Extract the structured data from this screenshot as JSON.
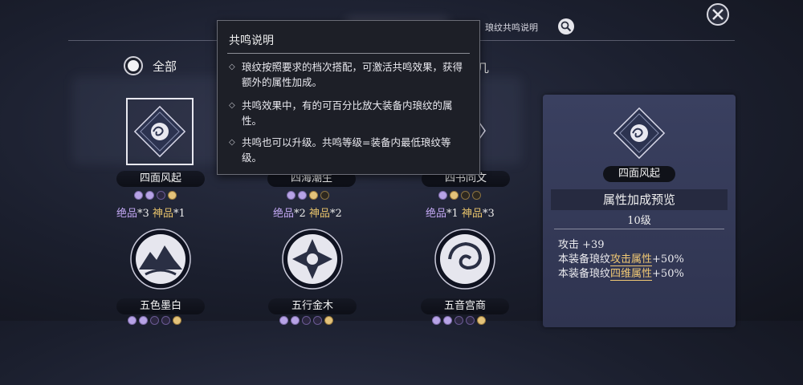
{
  "header": {
    "explain_link": "琅纹共鸣说明",
    "obscured_title": "共鸣"
  },
  "filter": {
    "all_label": "全部",
    "right_partial": "几"
  },
  "cards": [
    {
      "name": "四面风起",
      "purple_label": "绝品",
      "purple_count": "*3",
      "gold_label": "神品",
      "gold_count": "*1",
      "dots": [
        "p",
        "p",
        "pd",
        "g"
      ]
    },
    {
      "name": "四海潮生",
      "purple_label": "绝品",
      "purple_count": "*2",
      "gold_label": "神品",
      "gold_count": "*2",
      "dots": [
        "p",
        "p",
        "g",
        "gd"
      ]
    },
    {
      "name": "四书同文",
      "purple_label": "绝品",
      "purple_count": "*1",
      "gold_label": "神品",
      "gold_count": "*3",
      "dots": [
        "p",
        "g",
        "gd",
        "gd"
      ]
    },
    {
      "name": "五色墨白",
      "dots": [
        "p",
        "p",
        "pd",
        "pd",
        "g"
      ]
    },
    {
      "name": "五行金木",
      "dots": [
        "p",
        "p",
        "pd",
        "pd",
        "g"
      ]
    },
    {
      "name": "五音宫商",
      "dots": [
        "p",
        "p",
        "pd",
        "pd",
        "g"
      ]
    }
  ],
  "tooltip": {
    "title": "共鸣说明",
    "items": [
      "琅纹按照要求的档次搭配，可激活共鸣效果，获得额外的属性加成。",
      "共鸣效果中，有的可百分比放大装备内琅纹的属性。",
      "共鸣也可以升级。共鸣等级=装备内最低琅纹等级。"
    ]
  },
  "panel": {
    "name": "四面风起",
    "preview_title": "属性加成预览",
    "level": "10级",
    "stats": [
      {
        "prefix": "攻击 +39",
        "highlight": "",
        "suffix": ""
      },
      {
        "prefix": "本装备琅纹",
        "highlight": "攻击属性",
        "suffix": "+50%"
      },
      {
        "prefix": "本装备琅纹",
        "highlight": "四维属性",
        "suffix": "+50%"
      }
    ]
  },
  "icons": [
    "close-icon",
    "search-icon",
    "radio-icon",
    "wind-emblem-icon",
    "wave-emblem-icon",
    "book-emblem-icon",
    "ink-mountain-emblem-icon",
    "metal-wood-emblem-icon",
    "music-emblem-icon"
  ],
  "colors": {
    "purple_tier": "#c3a8f4",
    "gold_tier": "#e8c36b",
    "panel_bg": "#353b58"
  }
}
